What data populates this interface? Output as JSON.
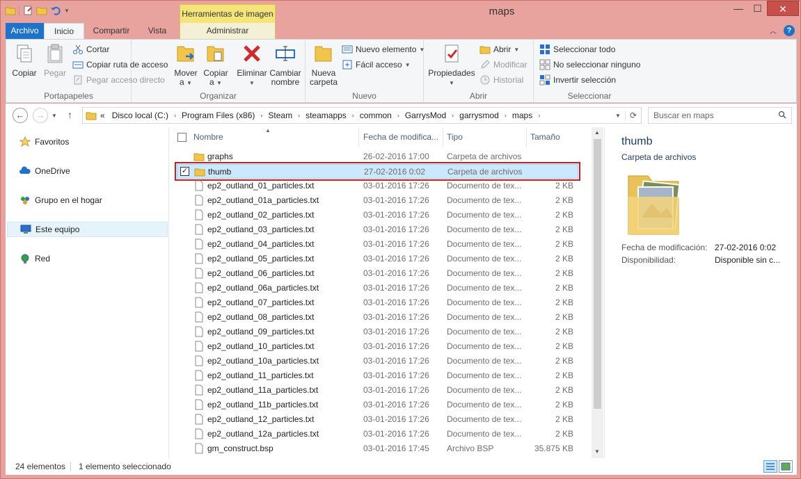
{
  "window": {
    "title": "maps",
    "context_tab_header": "Herramientas de imagen"
  },
  "tabs": {
    "archivo": "Archivo",
    "inicio": "Inicio",
    "compartir": "Compartir",
    "vista": "Vista",
    "administrar": "Administrar"
  },
  "ribbon": {
    "portapapeles": {
      "label": "Portapapeles",
      "copiar": "Copiar",
      "pegar": "Pegar",
      "cortar": "Cortar",
      "copiar_ruta": "Copiar ruta de acceso",
      "pegar_acceso": "Pegar acceso directo"
    },
    "organizar": {
      "label": "Organizar",
      "mover": "Mover",
      "mover2": "a",
      "copiar": "Copiar",
      "copiar2": "a",
      "eliminar": "Eliminar",
      "cambiar": "Cambiar",
      "cambiar2": "nombre"
    },
    "nuevo": {
      "label": "Nuevo",
      "nueva": "Nueva",
      "carpeta": "carpeta",
      "nuevo_elemento": "Nuevo elemento",
      "facil_acceso": "Fácil acceso"
    },
    "abrir": {
      "label": "Abrir",
      "propiedades": "Propiedades",
      "abrir": "Abrir",
      "modificar": "Modificar",
      "historial": "Historial"
    },
    "seleccionar": {
      "label": "Seleccionar",
      "todo": "Seleccionar todo",
      "ninguno": "No seleccionar ninguno",
      "invertir": "Invertir selección"
    }
  },
  "address": {
    "overflow": "«",
    "crumbs": [
      "Disco local (C:)",
      "Program Files (x86)",
      "Steam",
      "steamapps",
      "common",
      "GarrysMod",
      "garrysmod",
      "maps"
    ],
    "search_placeholder": "Buscar en maps"
  },
  "navpane": {
    "items": [
      "Favoritos",
      "OneDrive",
      "Grupo en el hogar",
      "Este equipo",
      "Red"
    ]
  },
  "columns": {
    "name": "Nombre",
    "date": "Fecha de modifica...",
    "type": "Tipo",
    "size": "Tamaño"
  },
  "files": [
    {
      "name": "graphs",
      "date": "26-02-2016 17:00",
      "type": "Carpeta de archivos",
      "size": ""
    },
    {
      "name": "thumb",
      "date": "27-02-2016 0:02",
      "type": "Carpeta de archivos",
      "size": ""
    },
    {
      "name": "ep2_outland_01_particles.txt",
      "date": "03-01-2016 17:26",
      "type": "Documento de tex...",
      "size": "2 KB"
    },
    {
      "name": "ep2_outland_01a_particles.txt",
      "date": "03-01-2016 17:26",
      "type": "Documento de tex...",
      "size": "2 KB"
    },
    {
      "name": "ep2_outland_02_particles.txt",
      "date": "03-01-2016 17:26",
      "type": "Documento de tex...",
      "size": "2 KB"
    },
    {
      "name": "ep2_outland_03_particles.txt",
      "date": "03-01-2016 17:26",
      "type": "Documento de tex...",
      "size": "2 KB"
    },
    {
      "name": "ep2_outland_04_particles.txt",
      "date": "03-01-2016 17:26",
      "type": "Documento de tex...",
      "size": "2 KB"
    },
    {
      "name": "ep2_outland_05_particles.txt",
      "date": "03-01-2016 17:26",
      "type": "Documento de tex...",
      "size": "2 KB"
    },
    {
      "name": "ep2_outland_06_particles.txt",
      "date": "03-01-2016 17:26",
      "type": "Documento de tex...",
      "size": "2 KB"
    },
    {
      "name": "ep2_outland_06a_particles.txt",
      "date": "03-01-2016 17:26",
      "type": "Documento de tex...",
      "size": "2 KB"
    },
    {
      "name": "ep2_outland_07_particles.txt",
      "date": "03-01-2016 17:26",
      "type": "Documento de tex...",
      "size": "2 KB"
    },
    {
      "name": "ep2_outland_08_particles.txt",
      "date": "03-01-2016 17:26",
      "type": "Documento de tex...",
      "size": "2 KB"
    },
    {
      "name": "ep2_outland_09_particles.txt",
      "date": "03-01-2016 17:26",
      "type": "Documento de tex...",
      "size": "2 KB"
    },
    {
      "name": "ep2_outland_10_particles.txt",
      "date": "03-01-2016 17:26",
      "type": "Documento de tex...",
      "size": "2 KB"
    },
    {
      "name": "ep2_outland_10a_particles.txt",
      "date": "03-01-2016 17:26",
      "type": "Documento de tex...",
      "size": "2 KB"
    },
    {
      "name": "ep2_outland_11_particles.txt",
      "date": "03-01-2016 17:26",
      "type": "Documento de tex...",
      "size": "2 KB"
    },
    {
      "name": "ep2_outland_11a_particles.txt",
      "date": "03-01-2016 17:26",
      "type": "Documento de tex...",
      "size": "2 KB"
    },
    {
      "name": "ep2_outland_11b_particles.txt",
      "date": "03-01-2016 17:26",
      "type": "Documento de tex...",
      "size": "2 KB"
    },
    {
      "name": "ep2_outland_12_particles.txt",
      "date": "03-01-2016 17:26",
      "type": "Documento de tex...",
      "size": "2 KB"
    },
    {
      "name": "ep2_outland_12a_particles.txt",
      "date": "03-01-2016 17:26",
      "type": "Documento de tex...",
      "size": "2 KB"
    },
    {
      "name": "gm_construct.bsp",
      "date": "03-01-2016 17:45",
      "type": "Archivo BSP",
      "size": "35.875 KB"
    }
  ],
  "preview": {
    "title": "thumb",
    "subtitle": "Carpeta de archivos",
    "mod_label": "Fecha de modificación:",
    "mod_value": "27-02-2016 0:02",
    "avail_label": "Disponibilidad:",
    "avail_value": "Disponible sin c..."
  },
  "status": {
    "count": "24 elementos",
    "selected": "1 elemento seleccionado"
  },
  "colors": {
    "accent": "#1e73c8",
    "selection": "#cce8ff",
    "highlight_outline": "#d21a1a",
    "frame": "#e9a39e"
  }
}
